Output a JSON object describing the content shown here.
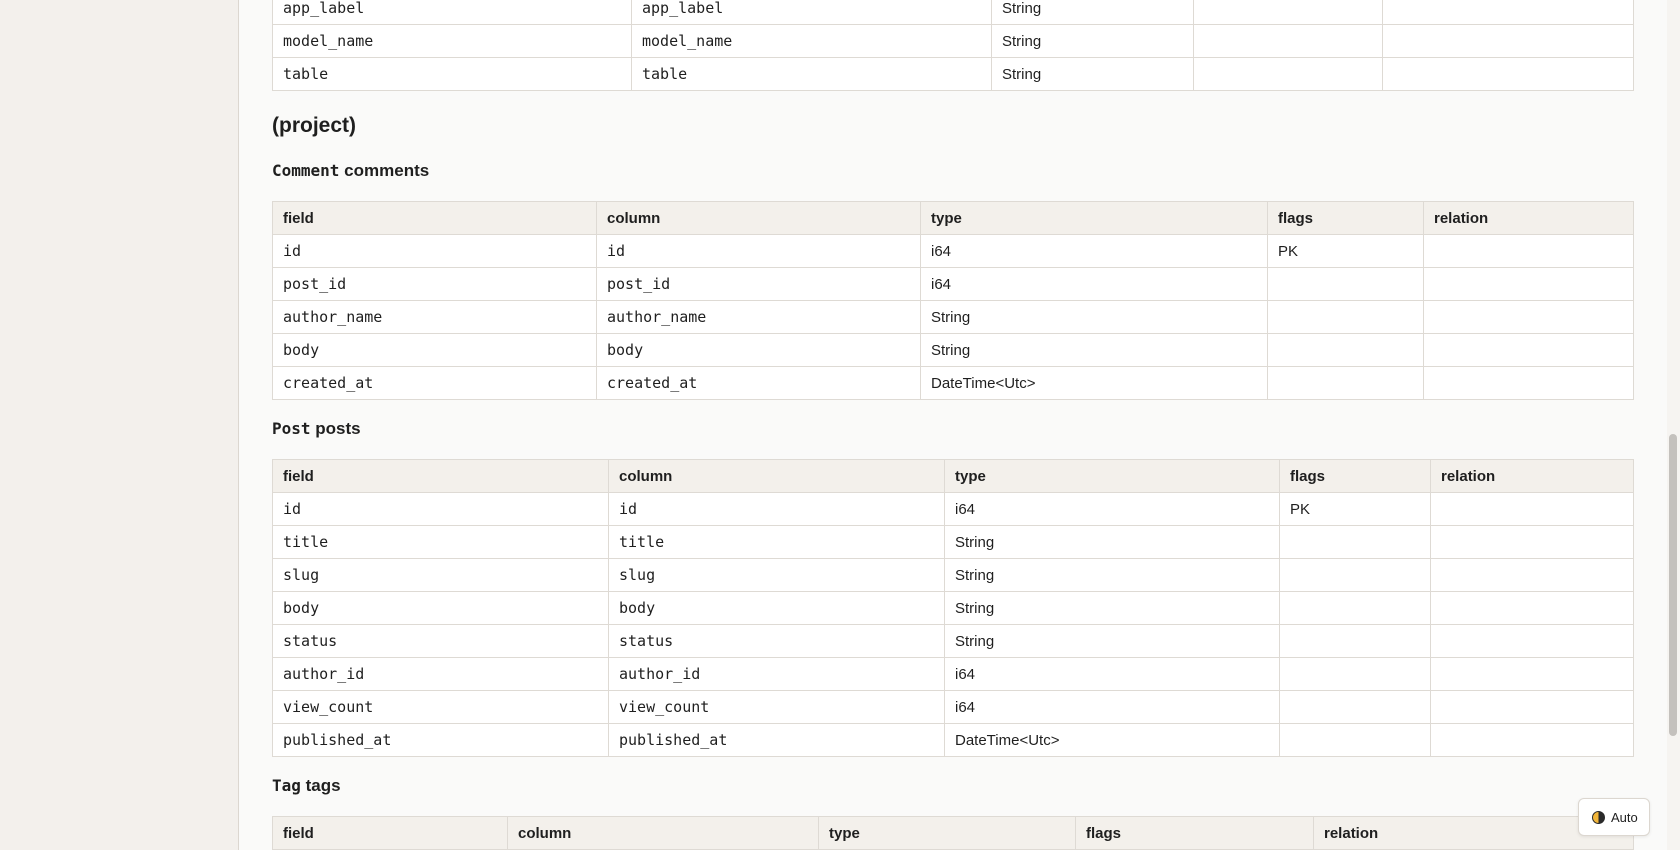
{
  "top_table": {
    "rows": [
      {
        "field": "app_label",
        "column": "app_label",
        "type": "String",
        "flags": "",
        "relation": ""
      },
      {
        "field": "model_name",
        "column": "model_name",
        "type": "String",
        "flags": "",
        "relation": ""
      },
      {
        "field": "table",
        "column": "table",
        "type": "String",
        "flags": "",
        "relation": ""
      }
    ]
  },
  "section": {
    "title": "(project)"
  },
  "headers": {
    "field": "field",
    "column": "column",
    "type": "type",
    "flags": "flags",
    "relation": "relation"
  },
  "models": [
    {
      "name": "Comment",
      "table": "comments",
      "rows": [
        {
          "field": "id",
          "column": "id",
          "type": "i64",
          "flags": "PK",
          "relation": ""
        },
        {
          "field": "post_id",
          "column": "post_id",
          "type": "i64",
          "flags": "",
          "relation": ""
        },
        {
          "field": "author_name",
          "column": "author_name",
          "type": "String",
          "flags": "",
          "relation": ""
        },
        {
          "field": "body",
          "column": "body",
          "type": "String",
          "flags": "",
          "relation": ""
        },
        {
          "field": "created_at",
          "column": "created_at",
          "type": "DateTime<Utc>",
          "flags": "",
          "relation": ""
        }
      ]
    },
    {
      "name": "Post",
      "table": "posts",
      "rows": [
        {
          "field": "id",
          "column": "id",
          "type": "i64",
          "flags": "PK",
          "relation": ""
        },
        {
          "field": "title",
          "column": "title",
          "type": "String",
          "flags": "",
          "relation": ""
        },
        {
          "field": "slug",
          "column": "slug",
          "type": "String",
          "flags": "",
          "relation": ""
        },
        {
          "field": "body",
          "column": "body",
          "type": "String",
          "flags": "",
          "relation": ""
        },
        {
          "field": "status",
          "column": "status",
          "type": "String",
          "flags": "",
          "relation": ""
        },
        {
          "field": "author_id",
          "column": "author_id",
          "type": "i64",
          "flags": "",
          "relation": ""
        },
        {
          "field": "view_count",
          "column": "view_count",
          "type": "i64",
          "flags": "",
          "relation": ""
        },
        {
          "field": "published_at",
          "column": "published_at",
          "type": "DateTime<Utc>",
          "flags": "",
          "relation": ""
        }
      ]
    },
    {
      "name": "Tag",
      "table": "tags",
      "rows": []
    }
  ],
  "theme_toggle": {
    "label": "Auto",
    "icon": "half-circle-theme-icon"
  }
}
